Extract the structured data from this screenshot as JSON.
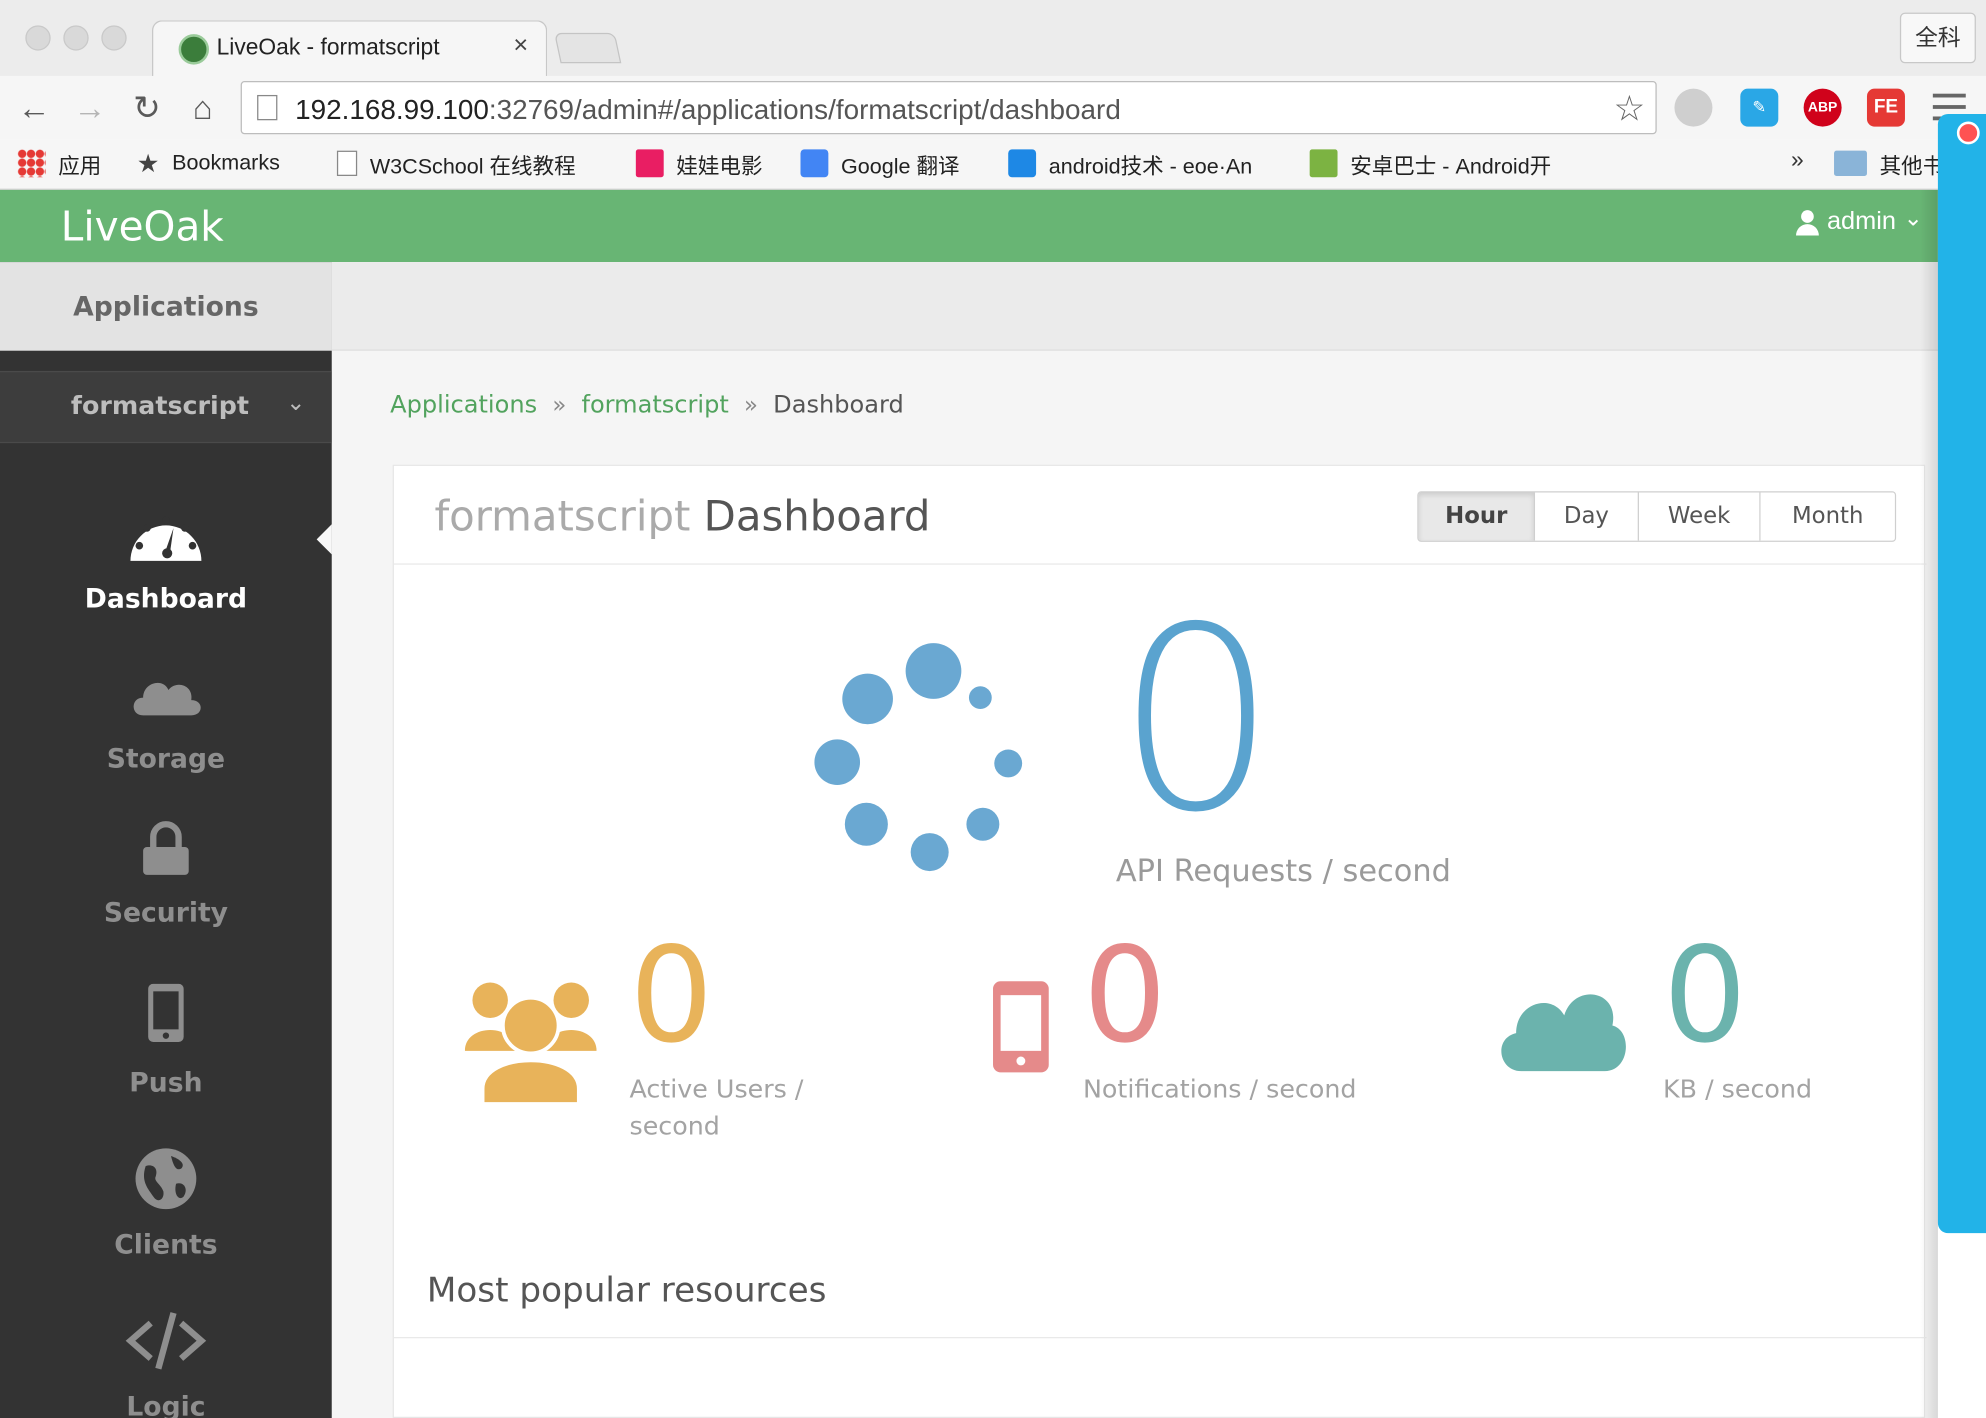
{
  "browser": {
    "tab_title": "LiveOak - formatscript",
    "tab_close": "×",
    "profile_label": "全科",
    "url_host": "192.168.99.100",
    "url_rest": ":32769/admin#/applications/formatscript/dashboard",
    "back_glyph": "←",
    "forward_glyph": "→",
    "reload_glyph": "↻",
    "home_glyph": "⌂",
    "star_glyph": "☆",
    "ext_abp": "ABP",
    "ext_fe": "FE",
    "bookmarks": [
      {
        "label": "应用",
        "icon": "apps-icon"
      },
      {
        "label": "Bookmarks",
        "icon": "star-icon"
      },
      {
        "label": "W3CSchool 在线教程",
        "icon": "page-icon"
      },
      {
        "label": "娃娃电影",
        "icon": "flash-icon"
      },
      {
        "label": "Google 翻译",
        "icon": "translate-icon"
      },
      {
        "label": "android技术 - eoe·An",
        "icon": "eoe-icon"
      },
      {
        "label": "安卓巴士 - Android开",
        "icon": "android-bus-icon"
      },
      {
        "label": "其他书",
        "icon": "folder-icon"
      }
    ],
    "more_glyph": "»"
  },
  "app": {
    "brand": "LiveOak",
    "user": "admin",
    "user_caret": "⌄"
  },
  "sidebar": {
    "applications_label": "Applications",
    "app_selector": "formatscript",
    "selector_caret": "⌄",
    "items": [
      {
        "label": "Dashboard",
        "icon": "dashboard-gauge-icon",
        "active": true
      },
      {
        "label": "Storage",
        "icon": "cloud-icon",
        "active": false
      },
      {
        "label": "Security",
        "icon": "lock-icon",
        "active": false
      },
      {
        "label": "Push",
        "icon": "mobile-icon",
        "active": false
      },
      {
        "label": "Clients",
        "icon": "globe-icon",
        "active": false
      },
      {
        "label": "Logic",
        "icon": "code-icon",
        "active": false
      }
    ]
  },
  "breadcrumb": {
    "items": [
      "Applications",
      "formatscript"
    ],
    "separator": "»",
    "current": "Dashboard"
  },
  "dashboard": {
    "title_app": "formatscript",
    "title_word": "Dashboard",
    "ranges": [
      "Hour",
      "Day",
      "Week",
      "Month"
    ],
    "active_range": "Hour",
    "api": {
      "value": "0",
      "label": "API Requests / second",
      "color": "#5aa3cf"
    },
    "stats": [
      {
        "value": "0",
        "label": "Active Users / second",
        "icon": "users-icon",
        "color": "#e8b35a"
      },
      {
        "value": "0",
        "label": "Notifications / second",
        "icon": "mobile-phone-icon",
        "color": "#e58a8a"
      },
      {
        "value": "0",
        "label": "KB / second",
        "icon": "cloud-icon",
        "color": "#6bb3ad"
      }
    ],
    "section_title": "Most popular resources"
  },
  "colors": {
    "header_green": "#68b574",
    "sidebar_dark": "#333333",
    "link_green": "#52a35e"
  }
}
